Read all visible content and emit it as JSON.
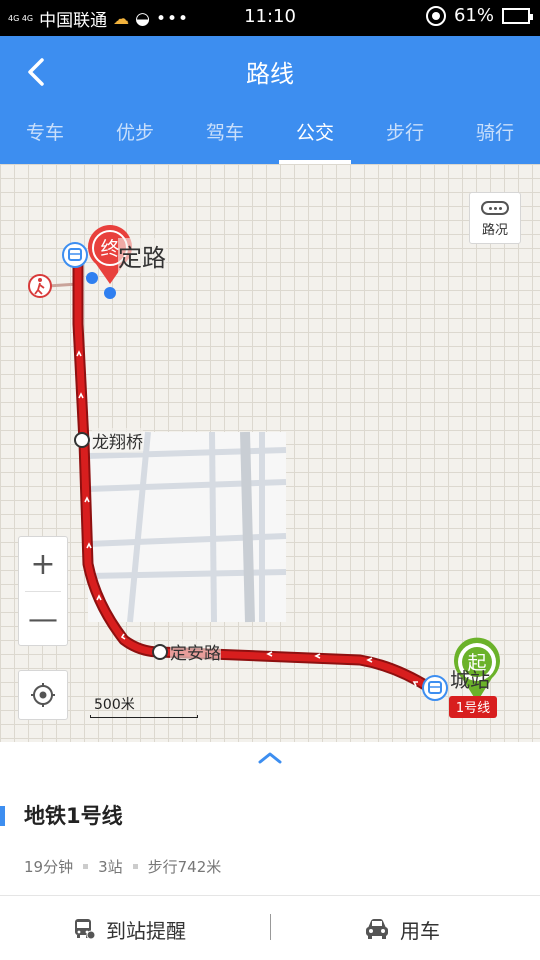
{
  "status_bar": {
    "network": "4G 4G",
    "carrier": "中国联通",
    "more": "•••",
    "time": "11:10",
    "battery": "61%",
    "battery_level": 0.61
  },
  "header": {
    "title": "路线",
    "tabs": [
      "专车",
      "优步",
      "驾车",
      "公交",
      "步行",
      "骑行"
    ],
    "active_tab": "公交"
  },
  "map": {
    "end_marker": "终",
    "start_marker": "起",
    "top_road_label": "定路",
    "stop_longxiang": "龙翔桥",
    "stop_dingan": "定安路",
    "start_place_label": "城站",
    "line_badge": "1号线",
    "traffic_label": "路况",
    "zoom_in": "+",
    "zoom_out": "—",
    "scale_label": "500米"
  },
  "route": {
    "name": "地铁1号线",
    "duration": "19分钟",
    "stops": "3站",
    "walk": "步行742米"
  },
  "actions": {
    "remind": "到站提醒",
    "car": "用车"
  },
  "colors": {
    "brand": "#3d8ef0",
    "route": "#d81e1e",
    "end_marker": "#e8403c",
    "start_marker": "#6bb22a"
  }
}
